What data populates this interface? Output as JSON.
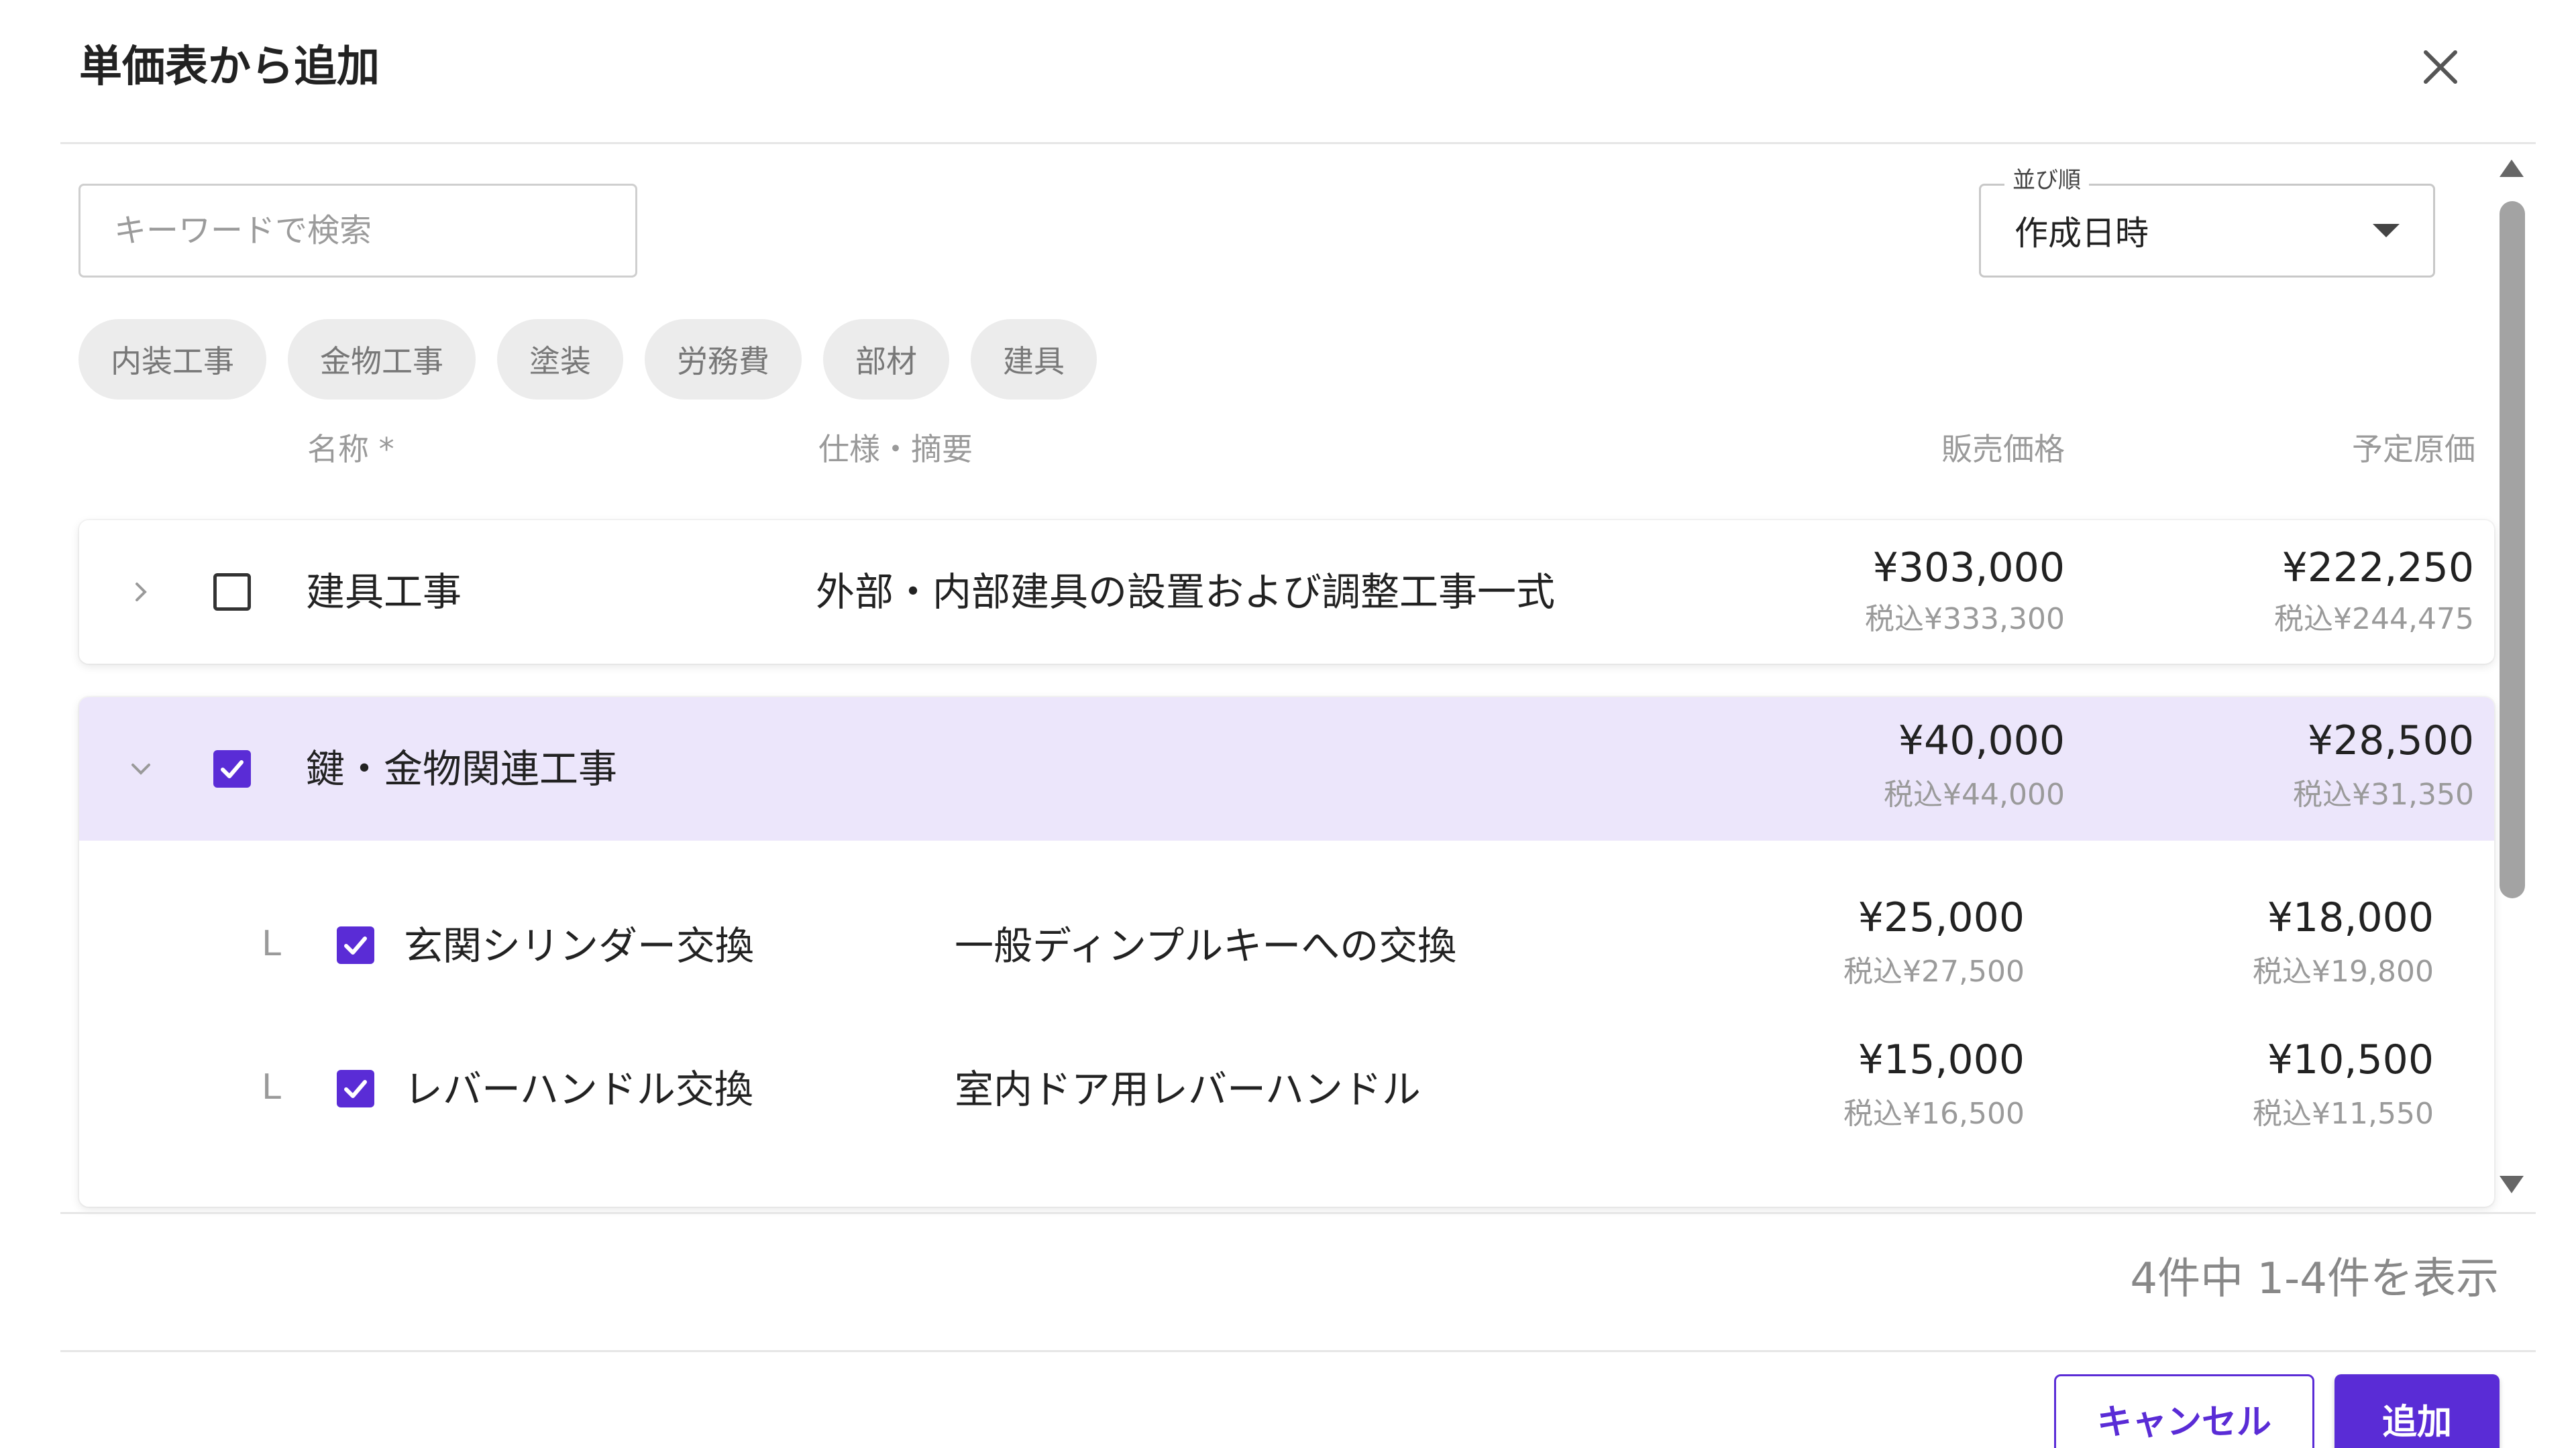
{
  "dialog": {
    "title": "単価表から追加"
  },
  "search": {
    "placeholder": "キーワードで検索",
    "value": ""
  },
  "sort": {
    "legend": "並び順",
    "value": "作成日時"
  },
  "chips": [
    "内装工事",
    "金物工事",
    "塗装",
    "労務費",
    "部材",
    "建具"
  ],
  "columns": {
    "name": "名称 *",
    "spec": "仕様・摘要",
    "sale": "販売価格",
    "cost": "予定原価"
  },
  "rows": [
    {
      "name": "建具工事",
      "spec": "外部・内部建具の設置および調整工事一式",
      "sale": "¥303,000",
      "sale_tax": "税込¥333,300",
      "cost": "¥222,250",
      "cost_tax": "税込¥244,475",
      "checked": false,
      "expanded": false
    },
    {
      "name": "鍵・金物関連工事",
      "spec": "",
      "sale": "¥40,000",
      "sale_tax": "税込¥44,000",
      "cost": "¥28,500",
      "cost_tax": "税込¥31,350",
      "checked": true,
      "expanded": true,
      "children": [
        {
          "mark": "L",
          "name": "玄関シリンダー交換",
          "spec": "一般ディンプルキーへの交換",
          "sale": "¥25,000",
          "sale_tax": "税込¥27,500",
          "cost": "¥18,000",
          "cost_tax": "税込¥19,800",
          "checked": true
        },
        {
          "mark": "L",
          "name": "レバーハンドル交換",
          "spec": "室内ドア用レバーハンドル",
          "sale": "¥15,000",
          "sale_tax": "税込¥16,500",
          "cost": "¥10,500",
          "cost_tax": "税込¥11,550",
          "checked": true
        }
      ]
    }
  ],
  "footer": {
    "count_text": "4件中 1-4件を表示",
    "cancel_label": "キャンセル",
    "add_label": "追加"
  },
  "colors": {
    "accent": "#5a2cd6",
    "selected_row": "#ece6fb"
  }
}
